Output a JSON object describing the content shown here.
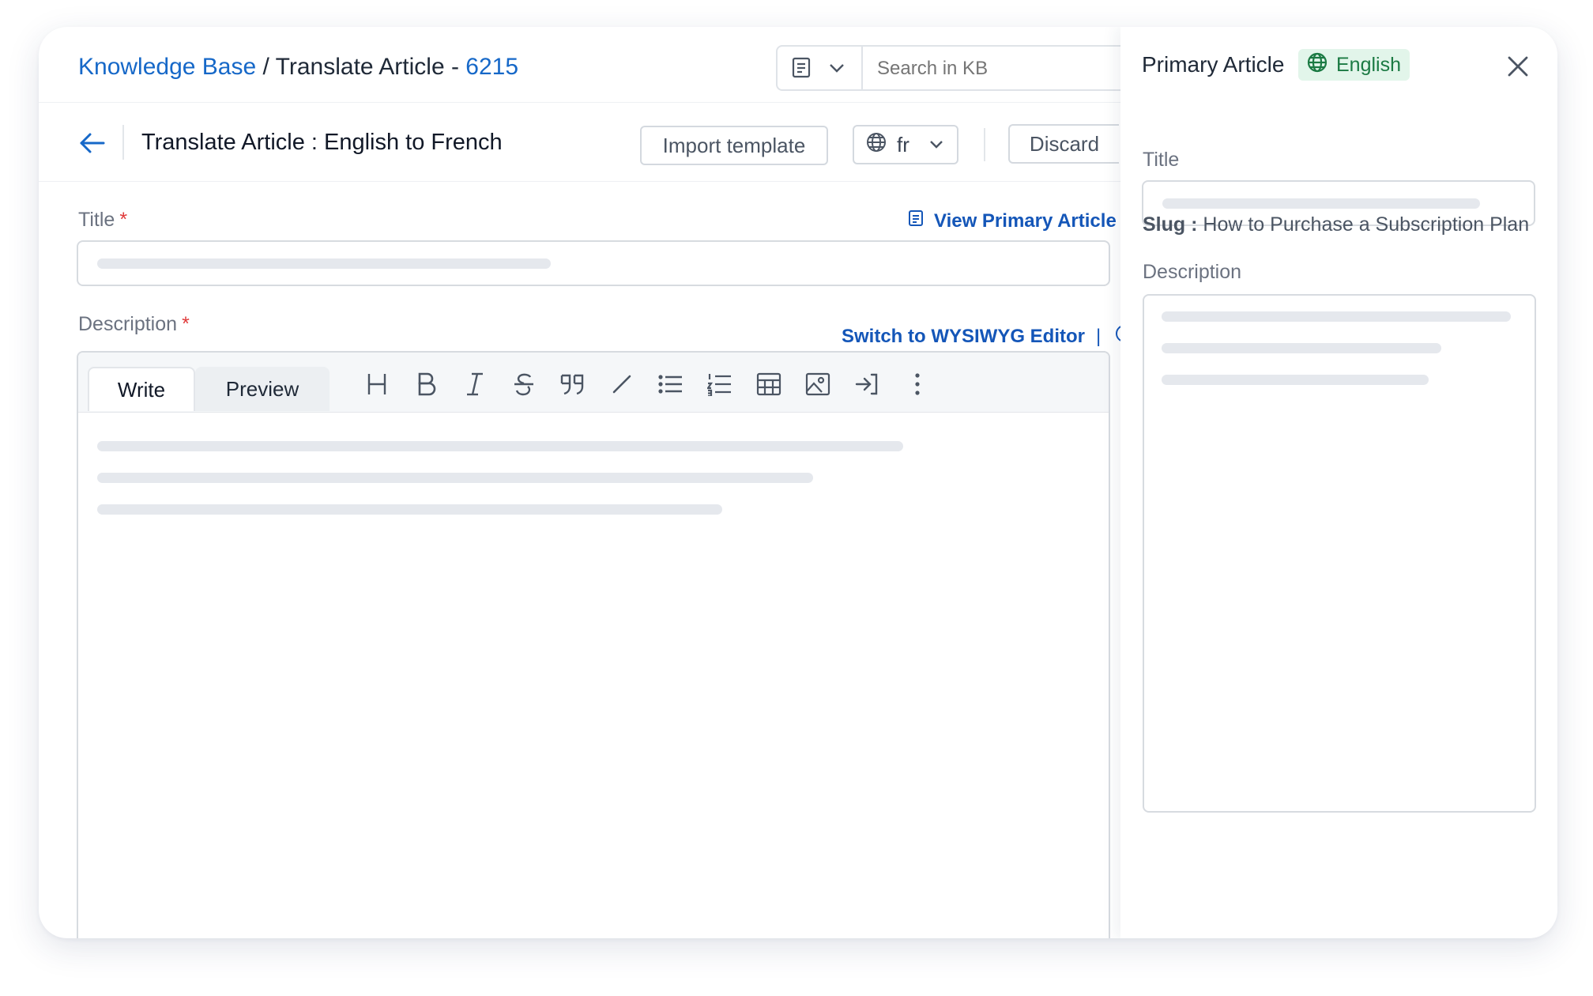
{
  "breadcrumb": {
    "root": "Knowledge Base",
    "separator": "/",
    "current": "Translate Article -",
    "article_id": "6215"
  },
  "search": {
    "placeholder": "Search in KB",
    "type_icon": "document-icon"
  },
  "header": {
    "title": "Translate Article : English to French",
    "import_template_label": "Import template",
    "language_value": "fr",
    "discard_label": "Discard"
  },
  "form": {
    "title_label": "Title",
    "description_label": "Description",
    "required_mark": "*",
    "view_primary_link": "View Primary Article",
    "switch_editor_link": "Switch to WYSIWYG Editor",
    "link_separator": "|"
  },
  "editor": {
    "tabs": [
      "Write",
      "Preview"
    ],
    "active_tab": "Write",
    "tools": [
      "heading-icon",
      "bold-icon",
      "italic-icon",
      "strikethrough-icon",
      "quote-icon",
      "slash-icon",
      "bulleted-list-icon",
      "numbered-list-icon",
      "table-icon",
      "image-icon",
      "insert-icon",
      "more-icon"
    ]
  },
  "panel": {
    "title": "Primary Article",
    "language_badge": "English",
    "title_label": "Title",
    "slug_key": "Slug :",
    "slug_value": "How to Purchase a Subscription Plan",
    "description_label": "Description"
  },
  "colors": {
    "link": "#1668c8",
    "required": "#e03a3a",
    "badge_bg": "#e2f5ea",
    "badge_text": "#1b7a43",
    "skeleton": "#e5e8ed"
  }
}
